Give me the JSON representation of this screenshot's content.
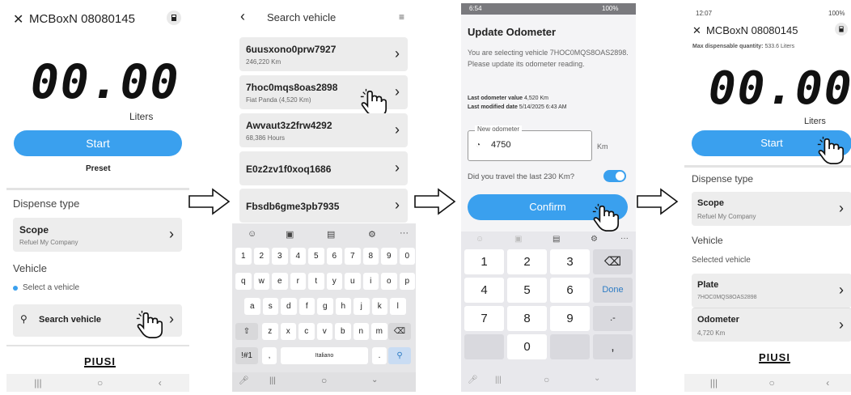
{
  "colors": {
    "accent": "#3aa0ee",
    "card": "#ededed",
    "toggle": "#3aa0ee"
  },
  "screen1": {
    "close_icon": "close-icon",
    "title": "MCBoxN 08080145",
    "fuel_icon": "fuel-pump-icon",
    "display_value": "00.00",
    "unit": "Liters",
    "start_label": "Start",
    "preset_label": "Preset",
    "dispense_type_label": "Dispense type",
    "scope_title": "Scope",
    "scope_sub": "Refuel My Company",
    "vehicle_label": "Vehicle",
    "select_vehicle": "Select a vehicle",
    "search_vehicle": "Search vehicle",
    "logo": "PIUSI"
  },
  "screen2": {
    "header_title": "Search vehicle",
    "vehicles": [
      {
        "name": "6uusxono0prw7927",
        "sub": "246,220 Km"
      },
      {
        "name": "7hoc0mqs8oas2898",
        "sub": "Fiat Panda (4,520 Km)"
      },
      {
        "name": "Awvaut3z2frw4292",
        "sub": "68,386 Hours"
      },
      {
        "name": "E0z2zv1f0xoq1686",
        "sub": ""
      },
      {
        "name": "Fbsdb6gme3pb7935",
        "sub": ""
      }
    ],
    "keyboard": {
      "row_numbers": [
        "1",
        "2",
        "3",
        "4",
        "5",
        "6",
        "7",
        "8",
        "9",
        "0"
      ],
      "row1": [
        "q",
        "w",
        "e",
        "r",
        "t",
        "y",
        "u",
        "i",
        "o",
        "p"
      ],
      "row2": [
        "a",
        "s",
        "d",
        "f",
        "g",
        "h",
        "j",
        "k",
        "l"
      ],
      "row3": [
        "z",
        "x",
        "c",
        "v",
        "b",
        "n",
        "m"
      ],
      "symbols_key": "!#1",
      "comma_key": ",",
      "space_label": "Italiano",
      "period_key": "."
    }
  },
  "screen3": {
    "status_time": "6:54",
    "status_battery": "100%",
    "title": "Update Odometer",
    "message": "You are selecting vehicle 7HOC0MQS8OAS2898. Please update its odometer reading.",
    "last_value_label": "Last odometer value",
    "last_value": "4,520 Km",
    "last_modified_label": "Last modified date",
    "last_modified": "5/14/2025 6:43 AM",
    "field_label": "New odometer",
    "field_value": "4750",
    "field_unit": "Km",
    "question": "Did you travel the last 230 Km?",
    "toggle_on": true,
    "confirm_label": "Confirm",
    "numpad": [
      "1",
      "2",
      "3",
      "4",
      "5",
      "6",
      "7",
      "8",
      "9",
      "0"
    ],
    "done_label": "Done",
    "dash_key": ".-",
    "comma_key": ","
  },
  "screen4": {
    "status_time": "12:07",
    "status_battery": "100%",
    "title": "MCBoxN 08080145",
    "max_label": "Max dispensable quantity:",
    "max_value": "533.6 Liters",
    "display_value": "00.00",
    "unit": "Liters",
    "start_label": "Start",
    "dispense_type_label": "Dispense type",
    "scope_title": "Scope",
    "scope_sub": "Refuel My Company",
    "vehicle_label": "Vehicle",
    "selected_vehicle_label": "Selected vehicle",
    "plate_title": "Plate",
    "plate_value": "7HOC0MQS8OAS2898",
    "odometer_title": "Odometer",
    "odometer_value": "4,720 Km",
    "logo": "PIUSI"
  }
}
